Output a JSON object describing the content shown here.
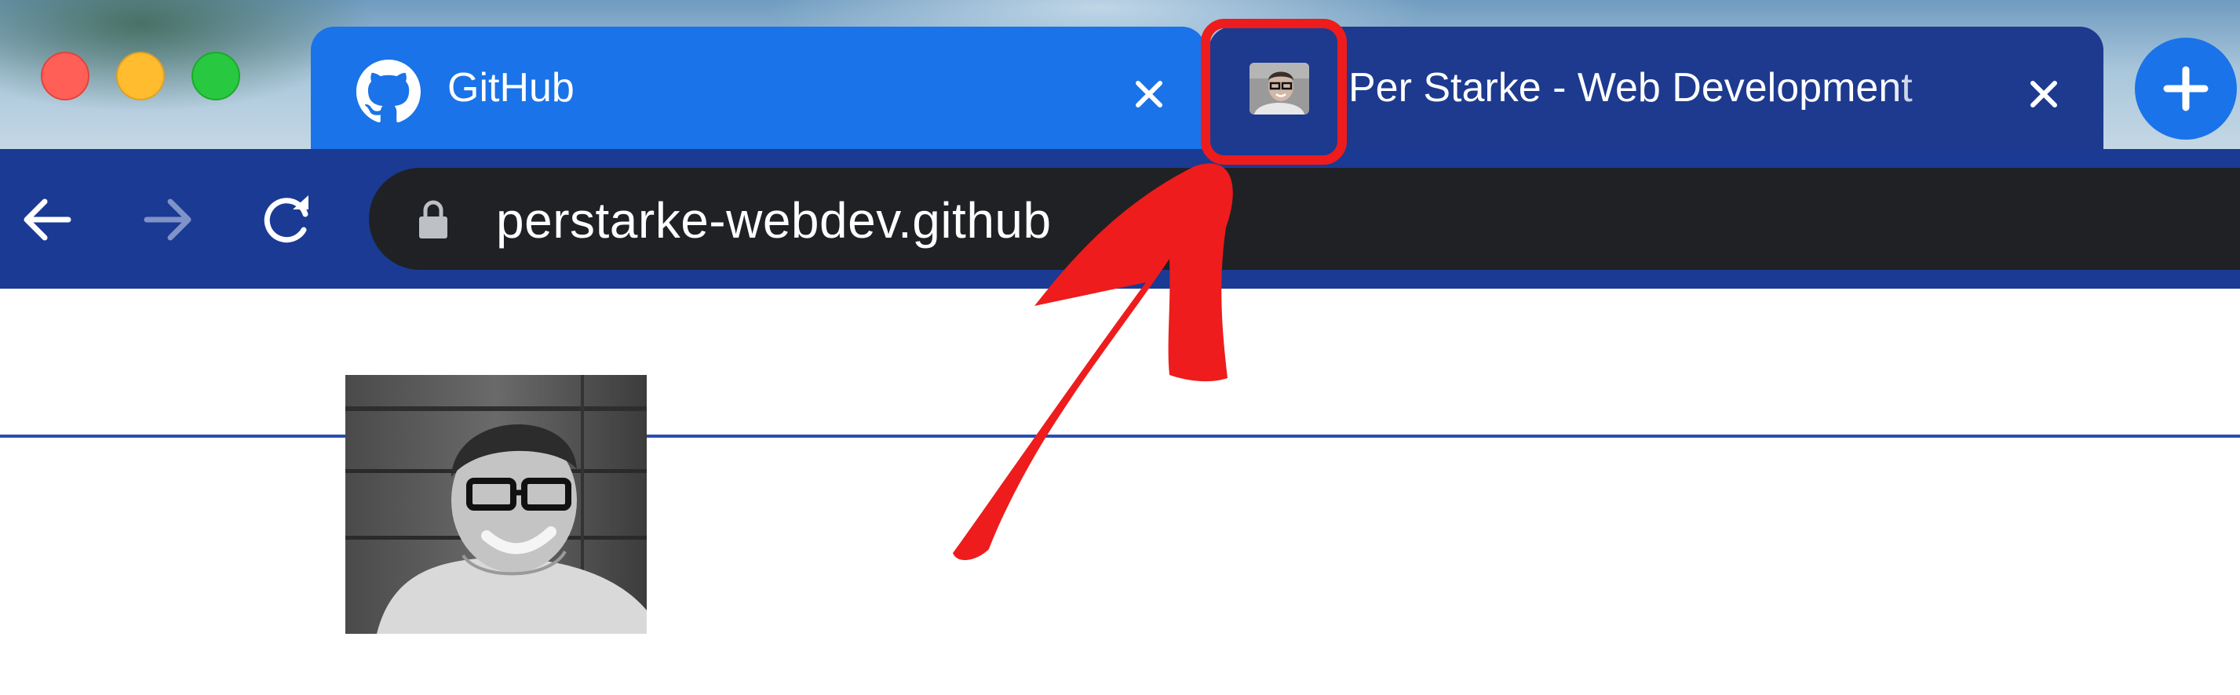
{
  "window": {
    "controls": [
      "close",
      "minimize",
      "maximize"
    ]
  },
  "tabs": [
    {
      "title": "GitHub",
      "icon": "github-icon",
      "active": true
    },
    {
      "title": "Per Starke - Web Development",
      "icon": "profile-favicon",
      "active": false
    }
  ],
  "toolbar": {
    "url": "perstarke-webdev.github",
    "icons": [
      "back-arrow-icon",
      "forward-arrow-icon",
      "reload-icon",
      "lock-icon",
      "plus-icon"
    ]
  },
  "colors": {
    "active_tab": "#1a73e8",
    "inactive_tab": "#1d3a8f",
    "toolbar": "#1a3a93",
    "omnibox": "#202124",
    "annotation": "#ee1c1c"
  },
  "annotation": {
    "type": "red-box-and-arrow",
    "target": "tab-favicon"
  }
}
